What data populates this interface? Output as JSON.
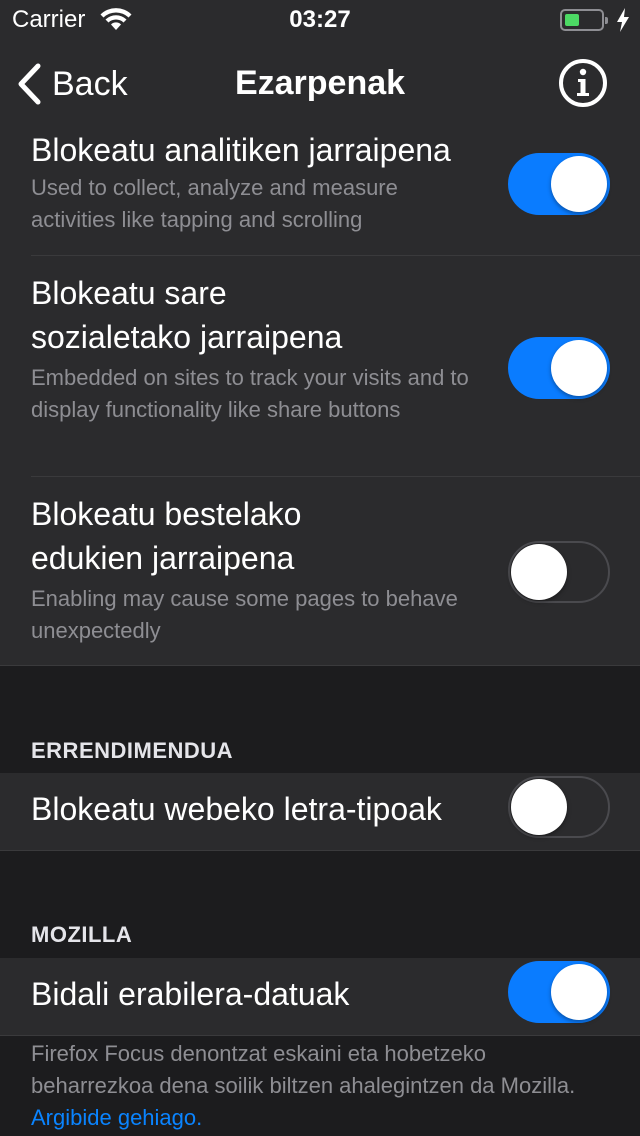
{
  "status": {
    "carrier": "Carrier",
    "time": "03:27"
  },
  "nav": {
    "back_label": "Back",
    "title": "Ezarpenak"
  },
  "tracking": {
    "analytics": {
      "title": "Blokeatu analitiken jarraipena",
      "subtitle": "Used to collect, analyze and measure activities like tapping and scrolling",
      "enabled": true
    },
    "social": {
      "title": "Blokeatu sare sozialetako jarraipena",
      "subtitle": "Embedded on sites to track your visits and to display functionality like share buttons",
      "enabled": true
    },
    "other": {
      "title": "Blokeatu bestelako edukien jarraipena",
      "subtitle": "Enabling may cause some pages to behave unexpectedly",
      "enabled": false
    }
  },
  "performance": {
    "header": "ERRENDIMENDUA",
    "web_fonts": {
      "title": "Blokeatu webeko letra-tipoak",
      "enabled": false
    }
  },
  "mozilla": {
    "header": "MOZILLA",
    "usage_data": {
      "title": "Bidali erabilera-datuak",
      "enabled": true
    },
    "footer_text": "Firefox Focus denontzat eskaini eta hobetzeko beharrezkoa dena soilik biltzen ahalegintzen da Mozilla.",
    "footer_link": "Argibide gehiago."
  },
  "colors": {
    "accent": "#0a7cff",
    "background": "#1c1c1e",
    "cell": "#2b2b2d",
    "secondary_text": "#8e8e93"
  },
  "icons": [
    "wifi-icon",
    "battery-icon",
    "charging-bolt-icon",
    "chevron-left-icon",
    "info-icon"
  ]
}
